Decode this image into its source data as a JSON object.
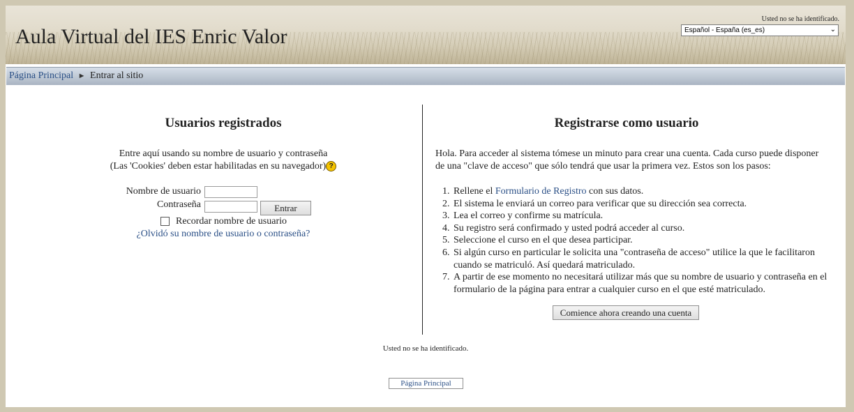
{
  "header": {
    "site_title": "Aula Virtual del IES Enric Valor",
    "login_info": "Usted no se ha identificado.",
    "language_selected": "Español - España (es_es)"
  },
  "navbar": {
    "home_link": "Página Principal",
    "separator": "►",
    "current": "Entrar al sitio"
  },
  "login": {
    "heading": "Usuarios registrados",
    "intro_line1": "Entre aquí usando su nombre de usuario y contraseña",
    "intro_line2": "(Las 'Cookies' deben estar habilitadas en su navegador)",
    "help_icon_glyph": "?",
    "username_label": "Nombre de usuario",
    "password_label": "Contraseña",
    "submit_label": "Entrar",
    "remember_label": "Recordar nombre de usuario",
    "forgot_link": "¿Olvidó su nombre de usuario o contraseña?"
  },
  "signup": {
    "heading": "Registrarse como usuario",
    "intro": "Hola. Para acceder al sistema tómese un minuto para crear una cuenta. Cada curso puede disponer de una \"clave de acceso\" que sólo tendrá que usar la primera vez. Estos son los pasos:",
    "step1_pre": "Rellene el ",
    "step1_link": "Formulario de Registro",
    "step1_post": " con sus datos.",
    "steps_rest": [
      "El sistema le enviará un correo para verificar que su dirección sea correcta.",
      "Lea el correo y confirme su matrícula.",
      "Su registro será confirmado y usted podrá acceder al curso.",
      "Seleccione el curso en el que desea participar.",
      "Si algún curso en particular le solicita una \"contraseña de acceso\" utilice la que le facilitaron cuando se matriculó. Así quedará matriculado.",
      "A partir de ese momento no necesitará utilizar más que su nombre de usuario y contraseña en el formulario de la página para entrar a cualquier curso en el que esté matriculado."
    ],
    "create_account_button": "Comience ahora creando una cuenta"
  },
  "footer": {
    "login_info": "Usted no se ha identificado.",
    "home_button": "Página Principal"
  }
}
